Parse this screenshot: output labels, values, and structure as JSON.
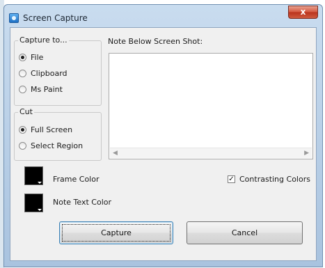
{
  "window": {
    "title": "Screen Capture",
    "close_label": "x"
  },
  "capture_to": {
    "label": "Capture to...",
    "options": [
      {
        "label": "File",
        "checked": true
      },
      {
        "label": "Clipboard",
        "checked": false
      },
      {
        "label": "Ms Paint",
        "checked": false
      }
    ]
  },
  "cut": {
    "label": "Cut",
    "options": [
      {
        "label": "Full Screen",
        "checked": true
      },
      {
        "label": "Select Region",
        "checked": false
      }
    ]
  },
  "note": {
    "label": "Note Below Screen Shot:",
    "value": ""
  },
  "colors": {
    "frame_label": "Frame Color",
    "frame_color": "#000000",
    "note_text_label": "Note Text Color",
    "note_text_color": "#000000"
  },
  "contrasting": {
    "label": "Contrasting Colors",
    "checked": true
  },
  "buttons": {
    "capture": "Capture",
    "cancel": "Cancel"
  }
}
